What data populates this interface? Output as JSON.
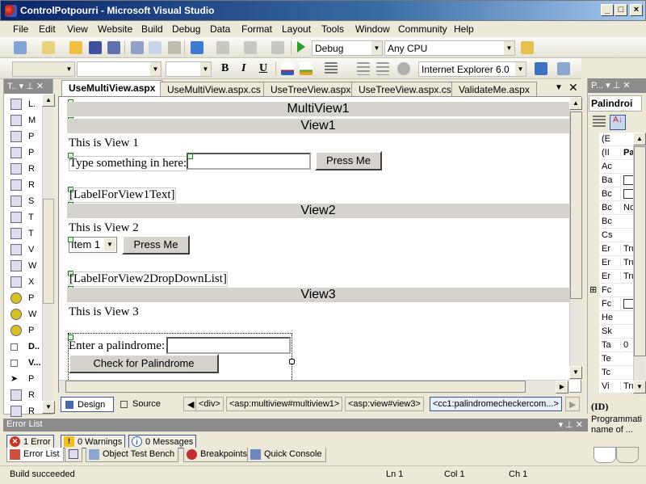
{
  "window": {
    "title": "ControlPotpourri - Microsoft Visual Studio"
  },
  "menu": [
    "File",
    "Edit",
    "View",
    "Website",
    "Build",
    "Debug",
    "Data",
    "Format",
    "Layout",
    "Tools",
    "Window",
    "Community",
    "Help"
  ],
  "toolbar": {
    "config": "Debug",
    "platform": "Any CPU",
    "browser_target": "Internet Explorer 6.0",
    "bold": "B",
    "italic": "I",
    "underline": "U"
  },
  "toolbox": {
    "title": "T..",
    "items": [
      {
        "label": "L.",
        "icon": "label-icon"
      },
      {
        "label": "M",
        "icon": "multiview-icon"
      },
      {
        "label": "P",
        "icon": "panel-icon"
      },
      {
        "label": "P",
        "icon": "placeholder-icon"
      },
      {
        "label": "R",
        "icon": "radiobutton-icon"
      },
      {
        "label": "R",
        "icon": "radiobuttonlist-icon"
      },
      {
        "label": "S",
        "icon": "substitution-icon"
      },
      {
        "label": "T",
        "icon": "table-icon"
      },
      {
        "label": "T",
        "icon": "textbox-icon"
      },
      {
        "label": "V",
        "icon": "view-icon"
      },
      {
        "label": "W",
        "icon": "wizard-icon"
      },
      {
        "label": "X",
        "icon": "xml-icon"
      },
      {
        "label": "P",
        "icon": "component-icon"
      },
      {
        "label": "W",
        "icon": "component-icon"
      },
      {
        "label": "P",
        "icon": "component-icon"
      },
      {
        "label": "D..",
        "icon": "expand-icon"
      },
      {
        "label": "V...",
        "icon": "collapse-icon"
      },
      {
        "label": "P",
        "icon": "pointer-icon"
      },
      {
        "label": "R",
        "icon": "requiredfieldvalidator-icon"
      },
      {
        "label": "R",
        "icon": "rangevalidator-icon"
      }
    ]
  },
  "tabs": [
    {
      "label": "UseMultiView.aspx",
      "active": true
    },
    {
      "label": "UseMultiView.aspx.cs"
    },
    {
      "label": "UseTreeView.aspx"
    },
    {
      "label": "UseTreeView.aspx.cs"
    },
    {
      "label": "ValidateMe.aspx"
    }
  ],
  "designer": {
    "multiview": "MultiView1",
    "view1": {
      "title": "View1",
      "text": "This is View 1",
      "prompt": "Type something in here:",
      "textbox_value": "",
      "button": "Press Me",
      "label": "[LabelForView1Text]"
    },
    "view2": {
      "title": "View2",
      "text": "This is View 2",
      "dropdown_value": "Item 1",
      "button": "Press Me",
      "label": "[LabelForView2DropDownList]"
    },
    "view3": {
      "title": "View3",
      "text": "This is View 3",
      "prompt": "Enter a palindrome:",
      "textbox_value": "",
      "button": "Check for Palindrome"
    }
  },
  "viewbar": {
    "design": "Design",
    "source": "Source",
    "crumbs": [
      "<div>",
      "<asp:multiview#multiview1>",
      "<asp:view#view3>",
      "<cc1:palindromecheckercom...>"
    ]
  },
  "properties": {
    "title": "P...",
    "object": "Palindroi",
    "rows": [
      {
        "n": "(E",
        "v": ""
      },
      {
        "n": "(II",
        "v": "Pali"
      },
      {
        "n": "Ac",
        "v": ""
      },
      {
        "n": "Ba",
        "v": "[ ]"
      },
      {
        "n": "Bc",
        "v": "[ ]"
      },
      {
        "n": "Bc",
        "v": "NotS"
      },
      {
        "n": "Bc",
        "v": ""
      },
      {
        "n": "Cs",
        "v": ""
      },
      {
        "n": "Er",
        "v": "True"
      },
      {
        "n": "Er",
        "v": "True"
      },
      {
        "n": "Er",
        "v": "True"
      },
      {
        "n": "Fc",
        "v": ""
      },
      {
        "n": "Fc",
        "v": "[ ]"
      },
      {
        "n": "He",
        "v": ""
      },
      {
        "n": "Sk",
        "v": ""
      },
      {
        "n": "Ta",
        "v": "0"
      },
      {
        "n": "Te",
        "v": ""
      },
      {
        "n": "Tc",
        "v": ""
      },
      {
        "n": "Vi",
        "v": "True"
      }
    ],
    "desc_title": "(ID)",
    "desc_text": "Programmati name of ..."
  },
  "errorlist": {
    "title": "Error List",
    "errors": "1 Error",
    "warnings": "0 Warnings",
    "messages": "0 Messages"
  },
  "bottomtabs": [
    "Error List",
    "",
    "Object Test Bench",
    "Breakpoints",
    "Quick Console"
  ],
  "status": {
    "text": "Build succeeded",
    "ln": "Ln 1",
    "col": "Col 1",
    "ch": "Ch 1"
  }
}
